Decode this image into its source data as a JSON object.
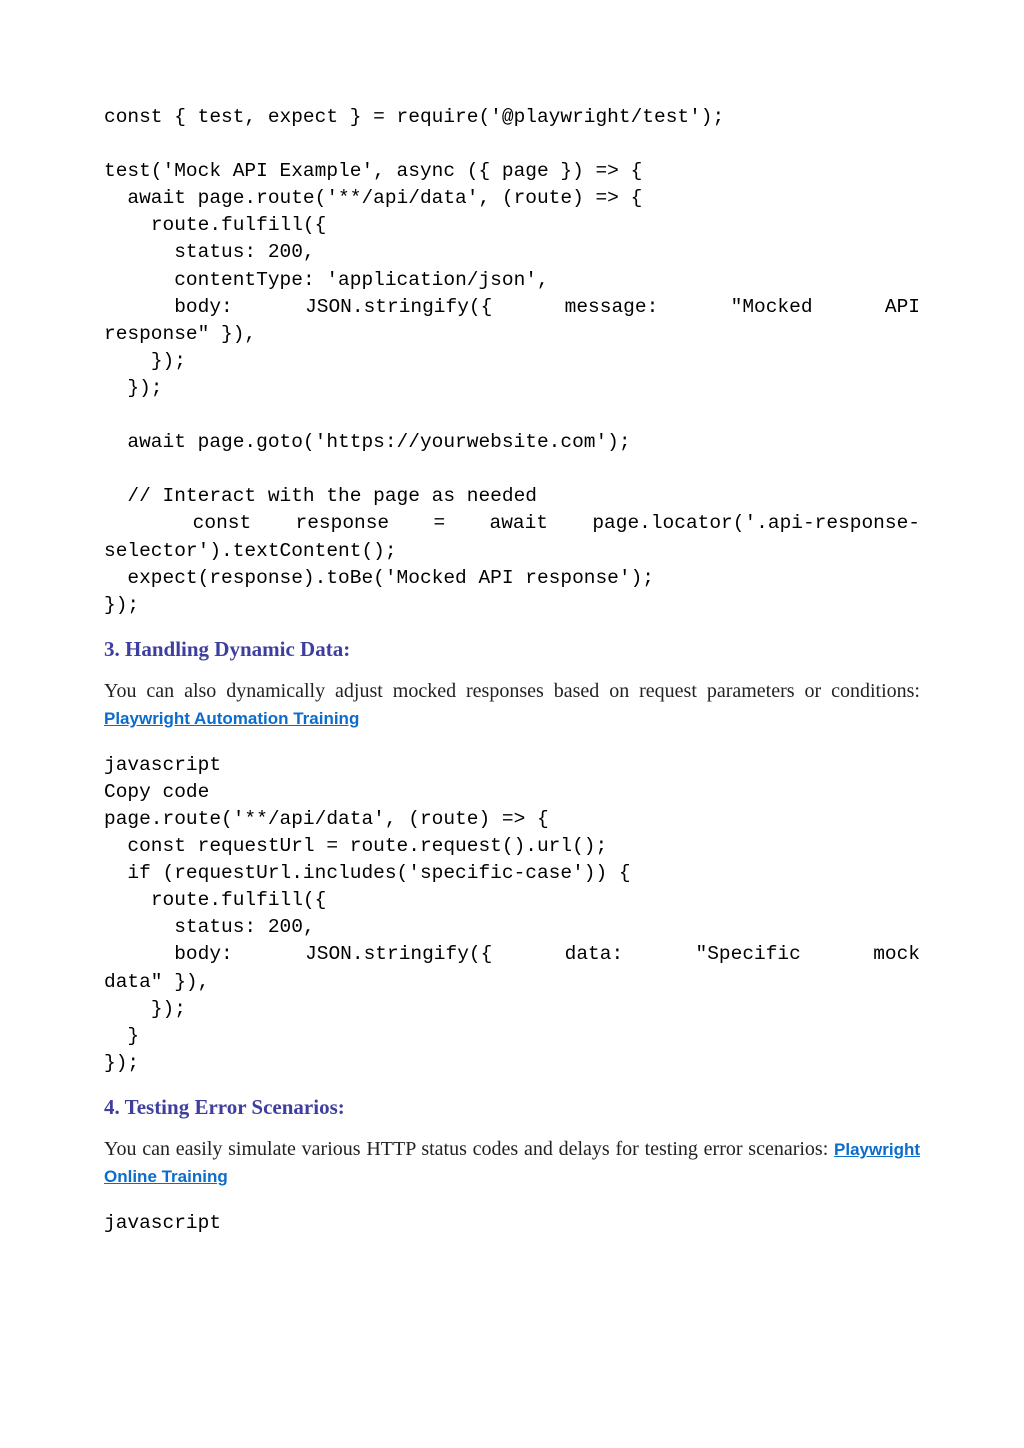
{
  "code1": {
    "line1": "const { test, expect } = require('@playwright/test');",
    "line2": "",
    "line3": "test('Mock API Example', async ({ page }) => {",
    "line4": "  await page.route('**/api/data', (route) => {",
    "line5": "    route.fulfill({",
    "line6": "      status: 200,",
    "line7": "      contentType: 'application/json',",
    "line8a": "body:",
    "line8b": "JSON.stringify({",
    "line8c": "message:",
    "line8d": "\"Mocked",
    "line8e": "API",
    "line9": "response\" }),",
    "line10": "    });",
    "line11": "  });",
    "line12": "",
    "line13": "  await page.goto('https://yourwebsite.com');",
    "line14": "",
    "line15": "  // Interact with the page as needed",
    "line16": "  const response = await page.locator('.api-response-",
    "line17": "selector').textContent();",
    "line18": "  expect(response).toBe('Mocked API response');",
    "line19": "});"
  },
  "heading3": "3. Handling Dynamic Data:",
  "para3_text": "You can also dynamically adjust mocked responses based on request parameters or conditions:  ",
  "para3_link": "Playwright Automation Training",
  "code2": {
    "line1": "javascript",
    "line2": "Copy code",
    "line3": "page.route('**/api/data', (route) => {",
    "line4": "  const requestUrl = route.request().url();",
    "line5": "  if (requestUrl.includes('specific-case')) {",
    "line6": "    route.fulfill({",
    "line7": "      status: 200,",
    "line8a": "body:",
    "line8b": "JSON.stringify({",
    "line8c": "data:",
    "line8d": "\"Specific",
    "line8e": "mock",
    "line9": "data\" }),",
    "line10": "    });",
    "line11": "  }",
    "line12": "});"
  },
  "heading4": "4. Testing Error Scenarios:",
  "para4_text": "You can easily simulate various HTTP status codes and delays for testing error scenarios:  ",
  "para4_link": "Playwright Online Training",
  "code3": {
    "line1": "javascript"
  }
}
